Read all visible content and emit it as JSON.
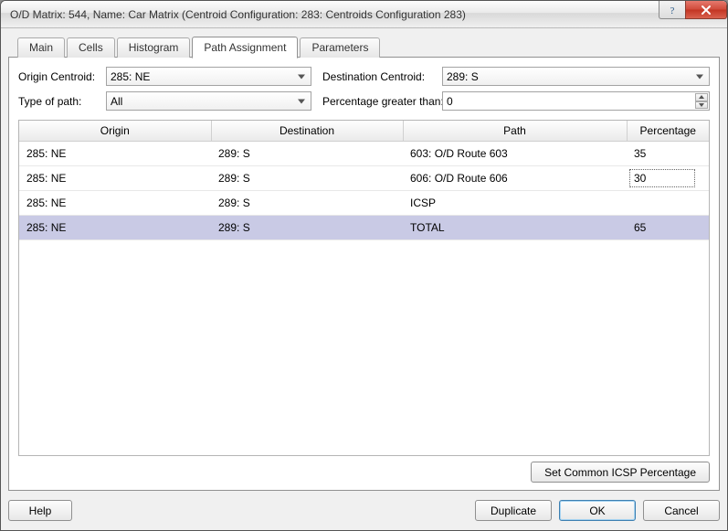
{
  "window": {
    "title": "O/D Matrix: 544, Name: Car Matrix  (Centroid Configuration: 283: Centroids Configuration 283)"
  },
  "tabs": [
    "Main",
    "Cells",
    "Histogram",
    "Path Assignment",
    "Parameters"
  ],
  "active_tab": 3,
  "form": {
    "origin_label": "Origin Centroid:",
    "origin_value": "285: NE",
    "dest_label": "Destination Centroid:",
    "dest_value": "289: S",
    "type_label": "Type of path:",
    "type_value": "All",
    "pct_label": "Percentage greater than:",
    "pct_value": "0"
  },
  "table": {
    "headers": [
      "Origin",
      "Destination",
      "Path",
      "Percentage"
    ],
    "rows": [
      {
        "origin": "285: NE",
        "dest": "289: S",
        "path": "603: O/D Route 603",
        "pct": "35",
        "editing": false,
        "total": false
      },
      {
        "origin": "285: NE",
        "dest": "289: S",
        "path": "606: O/D Route 606",
        "pct": "30",
        "editing": true,
        "total": false
      },
      {
        "origin": "285: NE",
        "dest": "289: S",
        "path": "ICSP",
        "pct": "",
        "editing": false,
        "total": false
      },
      {
        "origin": "285: NE",
        "dest": "289: S",
        "path": "TOTAL",
        "pct": "65",
        "editing": false,
        "total": true
      }
    ]
  },
  "buttons": {
    "set_common": "Set Common ICSP Percentage",
    "help": "Help",
    "duplicate": "Duplicate",
    "ok": "OK",
    "cancel": "Cancel"
  }
}
